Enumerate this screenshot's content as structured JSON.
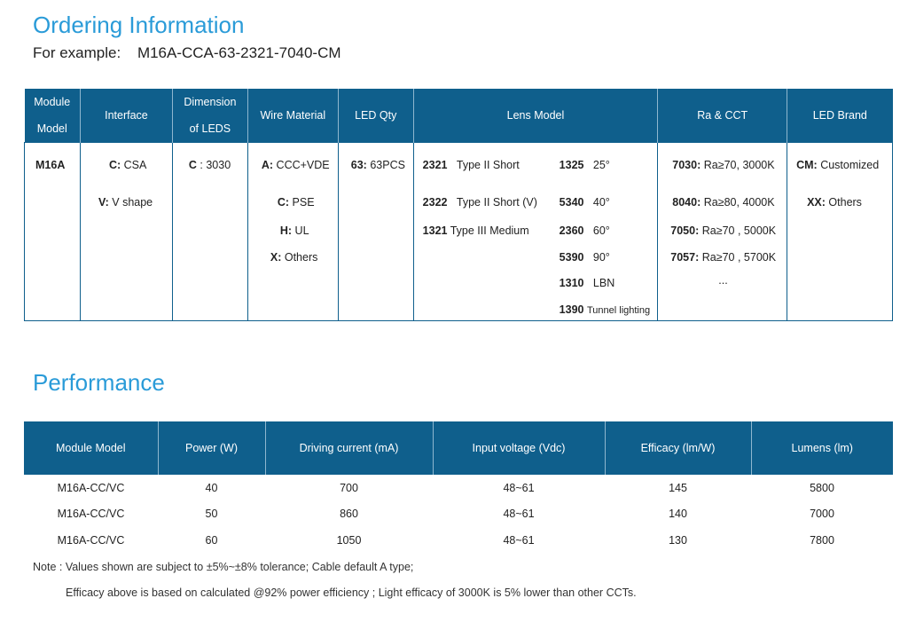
{
  "ordering": {
    "title": "Ordering Information",
    "example_label": "For example:",
    "example_code": "M16A-CCA-63-2321-7040-CM",
    "headers": {
      "module_model_1": "Module",
      "module_model_2": "Model",
      "interface": "Interface",
      "dimension_1": "Dimension",
      "dimension_2": "of LEDS",
      "wire_material": "Wire Material",
      "led_qty": "LED Qty",
      "lens_model": "Lens Model",
      "ra_cct": "Ra & CCT",
      "led_brand": "LED Brand"
    },
    "module_model": {
      "code": "M16A"
    },
    "interface": [
      {
        "code": "C:",
        "text": "CSA"
      },
      {
        "code": "V:",
        "text": "V shape"
      }
    ],
    "dimension": {
      "code": "C",
      "text": ": 3030"
    },
    "wire": [
      {
        "code": "A:",
        "text": "CCC+VDE"
      },
      {
        "code": "C:",
        "text": "PSE"
      },
      {
        "code": "H:",
        "text": "UL"
      },
      {
        "code": "X:",
        "text": "Others"
      }
    ],
    "led_qty": {
      "code": "63:",
      "text": "63PCS"
    },
    "lens_left": [
      {
        "code": "2321",
        "text": "Type II Short"
      },
      {
        "code": "2322",
        "text": "Type II Short (V)"
      },
      {
        "code": "1321",
        "text": "Type III Medium"
      }
    ],
    "lens_right": [
      {
        "code": "1325",
        "text": "25°"
      },
      {
        "code": "5340",
        "text": "40°"
      },
      {
        "code": "2360",
        "text": "60°"
      },
      {
        "code": "5390",
        "text": "90°"
      },
      {
        "code": "1310",
        "text": "LBN"
      },
      {
        "code": "1390",
        "text": "Tunnel lighting"
      }
    ],
    "ra_cct": [
      {
        "code": "7030:",
        "text": "Ra≥70, 3000K"
      },
      {
        "code": "8040:",
        "text": "Ra≥80, 4000K"
      },
      {
        "code": "7050:",
        "text": "Ra≥70 , 5000K"
      },
      {
        "code": "7057:",
        "text": "Ra≥70 , 5700K"
      },
      {
        "code": "",
        "text": "..."
      }
    ],
    "brand": [
      {
        "code": "CM:",
        "text": "Customized"
      },
      {
        "code": "XX:",
        "text": "Others"
      }
    ]
  },
  "performance": {
    "title": "Performance",
    "headers": [
      "Module Model",
      "Power (W)",
      "Driving current (mA)",
      "Input voltage (Vdc)",
      "Efficacy (lm/W)",
      "Lumens (lm)"
    ],
    "rows": [
      [
        "M16A-CC/VC",
        "40",
        "700",
        "48~61",
        "145",
        "5800"
      ],
      [
        "M16A-CC/VC",
        "50",
        "860",
        "48~61",
        "140",
        "7000"
      ],
      [
        "M16A-CC/VC",
        "60",
        "1050",
        "48~61",
        "130",
        "7800"
      ]
    ]
  },
  "notes": {
    "line1": "Note : Values shown are subject to ±5%~±8% tolerance; Cable default A type;",
    "line2": "Efficacy above is based on calculated @92% power efficiency ; Light efficacy of 3000K is 5% lower than other CCTs."
  }
}
